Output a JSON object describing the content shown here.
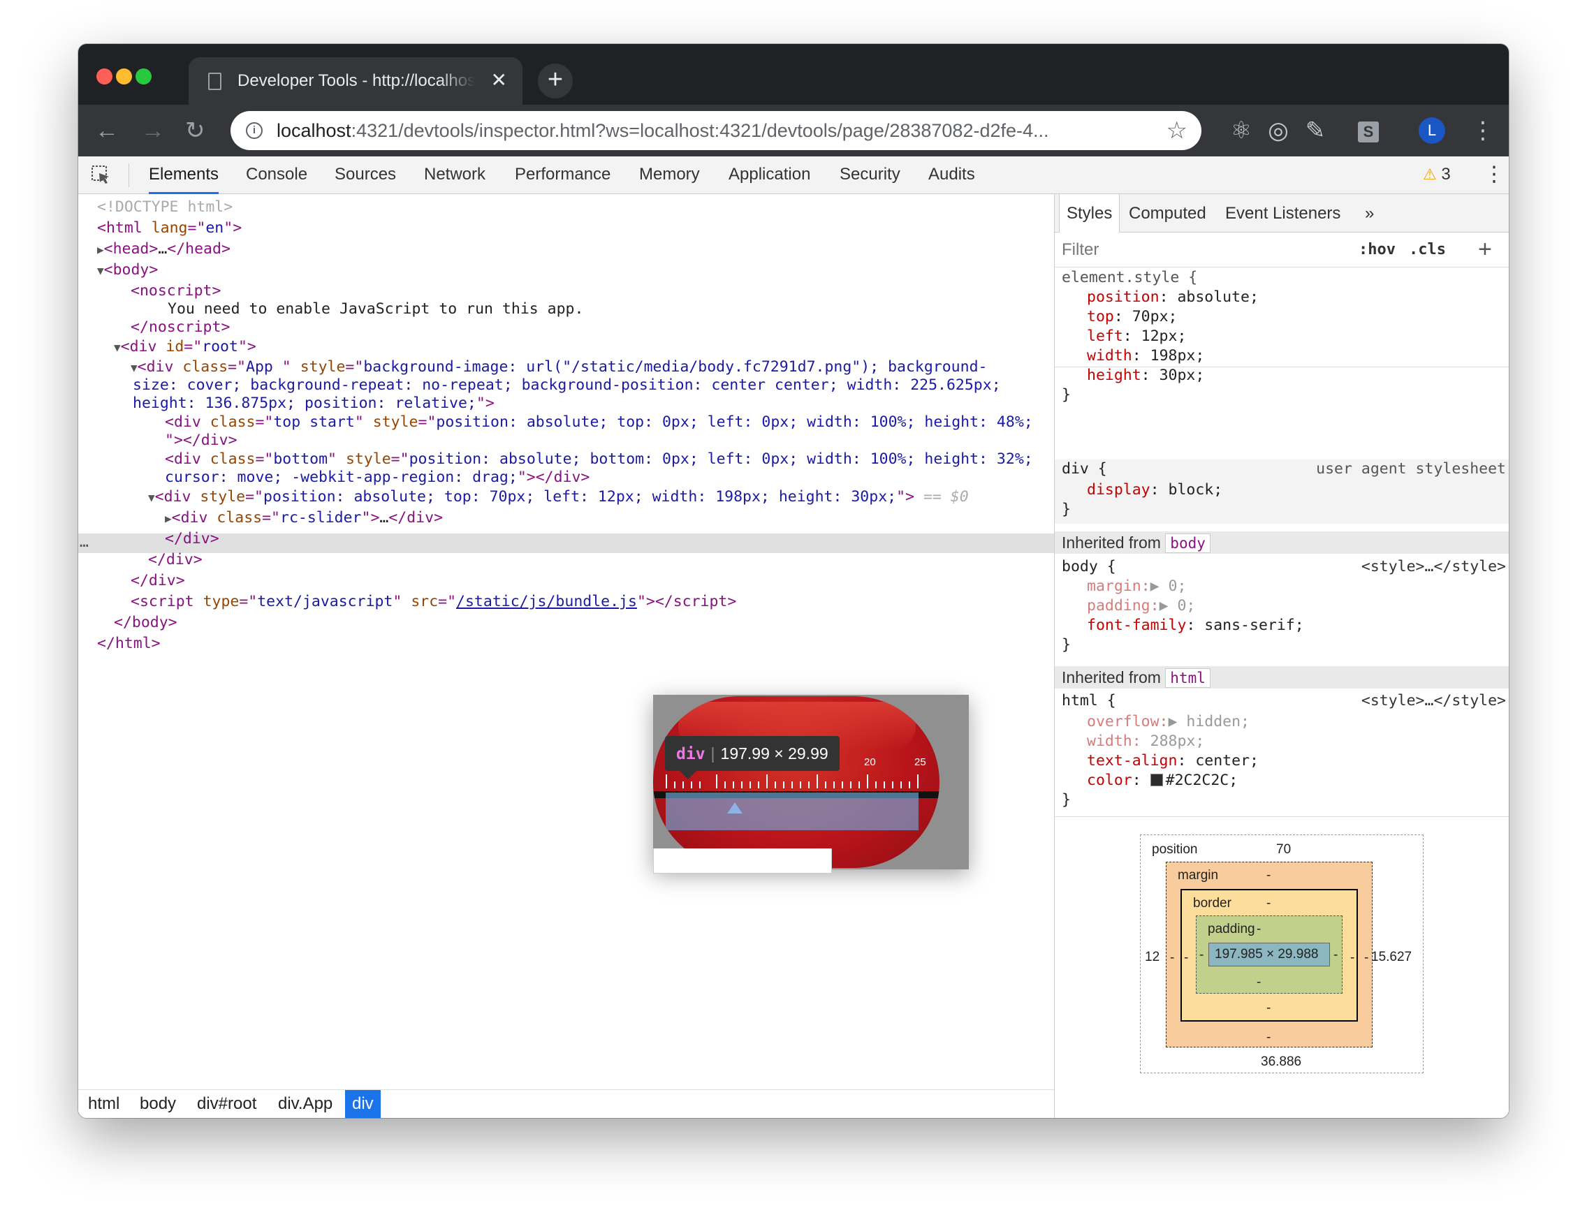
{
  "browser": {
    "tab_title": "Developer Tools - http://localhost:4321/devtools/inspector.html",
    "url_host": "localhost",
    "url_rest": ":4321/devtools/inspector.html?ws=localhost:4321/devtools/page/28387082-d2fe-4...",
    "avatar_letter": "L",
    "ext_s_letter": "S"
  },
  "devtools": {
    "tabs": [
      "Elements",
      "Console",
      "Sources",
      "Network",
      "Performance",
      "Memory",
      "Application",
      "Security",
      "Audits"
    ],
    "active_tab": "Elements",
    "warnings_count": "3"
  },
  "dom": {
    "doctype": "<!DOCTYPE html>",
    "html_open_tag": "html",
    "html_lang_attr": "lang",
    "html_lang_val": "en",
    "head_line": "head",
    "noscript_text": "You need to enable JavaScript to run this app.",
    "root_id": "root",
    "app_class": "App ",
    "app_style_1": "background-image: url(\"/static/media/body.fc7291d7.png\"); background-",
    "app_style_2": "size: cover; background-repeat: no-repeat; background-position: center center; width: 225.625px;",
    "app_style_3": "height: 136.875px; position: relative;",
    "top_class": "top start",
    "top_style": "position: absolute; top: 0px; left: 0px; width: 100%; height: 48%;",
    "bottom_class": "bottom",
    "bottom_style_1": "position: absolute; bottom: 0px; left: 0px; width: 100%; height: 32%;",
    "bottom_style_2": "cursor: move; -webkit-app-region: drag;",
    "selected_style": "position: absolute; top: 70px; left: 12px; width: 198px; height: 30px;",
    "selected_marker": "== $0",
    "slider_class": "rc-slider",
    "script_type": "text/javascript",
    "script_src": "/static/js/bundle.js"
  },
  "breadcrumbs": [
    "html",
    "body",
    "div#root",
    "div.App",
    "div"
  ],
  "sidebar": {
    "tabs": [
      "Styles",
      "Computed",
      "Event Listeners"
    ],
    "more": "»",
    "filter_placeholder": "Filter",
    "hov": ":hov",
    "cls": ".cls",
    "element_style": {
      "selector": "element.style {",
      "props": [
        {
          "name": "position",
          "value": "absolute;"
        },
        {
          "name": "top",
          "value": "70px;"
        },
        {
          "name": "left",
          "value": "12px;"
        },
        {
          "name": "width",
          "value": "198px;"
        },
        {
          "name": "height",
          "value": "30px;"
        }
      ]
    },
    "ua_rule": {
      "selector": "div {",
      "source": "user agent stylesheet",
      "prop": "display",
      "value": "block;"
    },
    "inherited_body": {
      "label": "Inherited from",
      "tag": "body",
      "selector": "body {",
      "source": "<style>…</style>",
      "margin": "margin:",
      "margin_val": "0;",
      "padding": "padding:",
      "padding_val": "0;",
      "font_family": "font-family",
      "font_family_val": "sans-serif;"
    },
    "inherited_html": {
      "label": "Inherited from",
      "tag": "html",
      "selector": "html {",
      "source": "<style>…</style>",
      "overflow": "overflow:",
      "overflow_val": "hidden;",
      "width": "width:",
      "width_val": "288px;",
      "text_align": "text-align",
      "text_align_val": "center;",
      "color": "color",
      "color_val": "#2C2C2C;"
    },
    "box_model": {
      "position_label": "position",
      "position_top": "70",
      "position_left": "12",
      "position_right": "15.627",
      "position_bottom": "36.886",
      "margin_label": "margin",
      "border_label": "border",
      "padding_label": "padding",
      "dash": "-",
      "content": "197.985 × 29.988"
    }
  },
  "overlay": {
    "tooltip_tag": "div",
    "tooltip_size": "197.99 × 29.99",
    "ruler_labels": [
      "20",
      "25"
    ]
  },
  "colors": {
    "highlight_blue": "#1a73e8",
    "pill_red": "#b9141a"
  }
}
